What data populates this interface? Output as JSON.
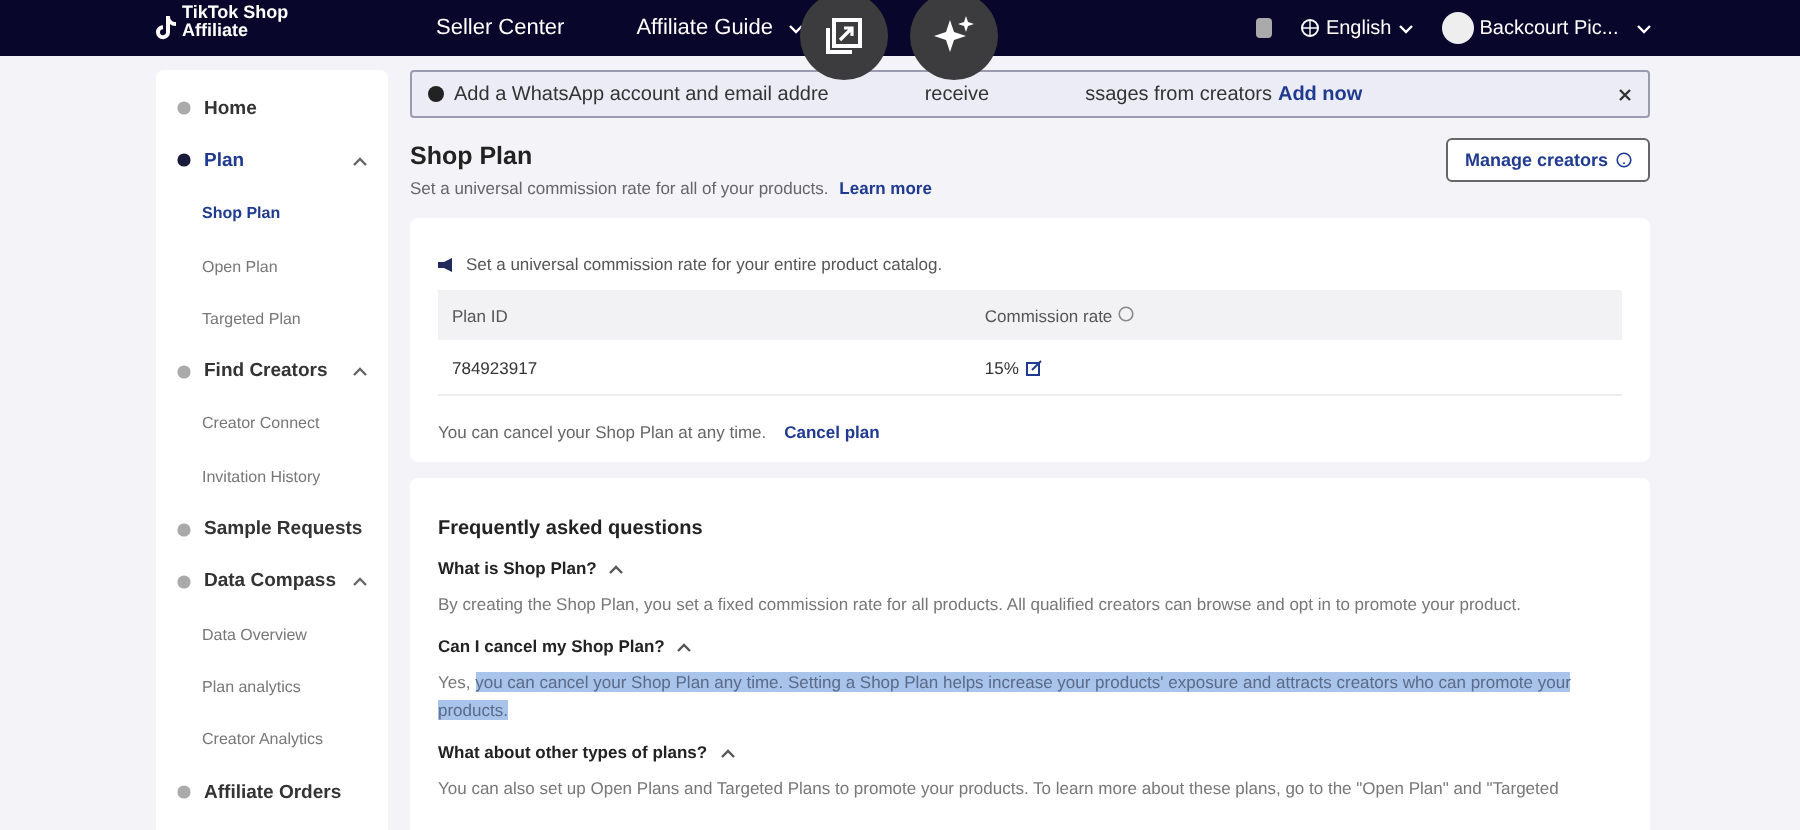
{
  "top_bar": {
    "logo": [
      "TikTok Shop",
      "Affiliate"
    ],
    "nav": [
      {
        "label": "Seller Center",
        "has_dropdown": false
      },
      {
        "label": "Affiliate Guide",
        "has_dropdown": true
      }
    ],
    "language": "English",
    "account": "Backcourt Pic..."
  },
  "sidebar": {
    "items": [
      {
        "label": "Home",
        "selected": false
      },
      {
        "label": "Plan",
        "selected": true,
        "expanded": true,
        "children": [
          {
            "label": "Shop Plan",
            "selected": true
          },
          {
            "label": "Open Plan",
            "selected": false
          },
          {
            "label": "Targeted Plan",
            "selected": false
          }
        ]
      },
      {
        "label": "Find Creators",
        "selected": false,
        "expanded": true,
        "children": [
          {
            "label": "Creator Connect",
            "selected": false
          },
          {
            "label": "Invitation History",
            "selected": false
          }
        ]
      },
      {
        "label": "Sample Requests",
        "selected": false
      },
      {
        "label": "Data Compass",
        "selected": false,
        "expanded": true,
        "children": [
          {
            "label": "Data Overview",
            "selected": false
          },
          {
            "label": "Plan analytics",
            "selected": false
          },
          {
            "label": "Creator Analytics",
            "selected": false
          }
        ]
      },
      {
        "label": "Affiliate Orders",
        "selected": false
      }
    ]
  },
  "banner": {
    "text_parts": [
      "Add a WhatsApp account and email addre",
      "receive",
      "ssages from creators"
    ],
    "link": "Add now"
  },
  "header": {
    "title": "Shop Plan",
    "subtitle": "Set a universal commission rate for all of your products.",
    "link": "Learn more",
    "button": "Manage creators"
  },
  "plan_card": {
    "notice": "Set a universal commission rate for your entire product catalog.",
    "table": {
      "columns": [
        "Plan ID",
        "Commission rate"
      ],
      "rows": [
        [
          "784923917",
          "15%"
        ]
      ]
    },
    "cancel_text": "You can cancel your Shop Plan at any time.",
    "cancel_link": "Cancel plan"
  },
  "faq": {
    "title": "Frequently asked questions",
    "items": [
      {
        "question": "What is Shop Plan?",
        "expanded": true,
        "answer": [
          {
            "text": "By creating the Shop Plan, you set a fixed commission rate for all products. All qualified creators can browse and opt in to promote your product.",
            "selected": false
          }
        ]
      },
      {
        "question": "Can I cancel my Shop Plan?",
        "expanded": true,
        "answer": [
          {
            "text": "Yes, ",
            "selected": false
          },
          {
            "text": "you can cancel your Shop Plan any time. Setting a Shop Plan helps increase your products' exposure and attracts creators who can promote your products.",
            "selected": true
          }
        ]
      },
      {
        "question": "What about other types of plans?",
        "expanded": true,
        "answer": [
          {
            "text": "You can also set up Open Plans and Targeted Plans to promote your products. To learn more about these plans, go to the \"Open Plan\" and \"Targeted",
            "selected": false
          }
        ]
      }
    ]
  }
}
